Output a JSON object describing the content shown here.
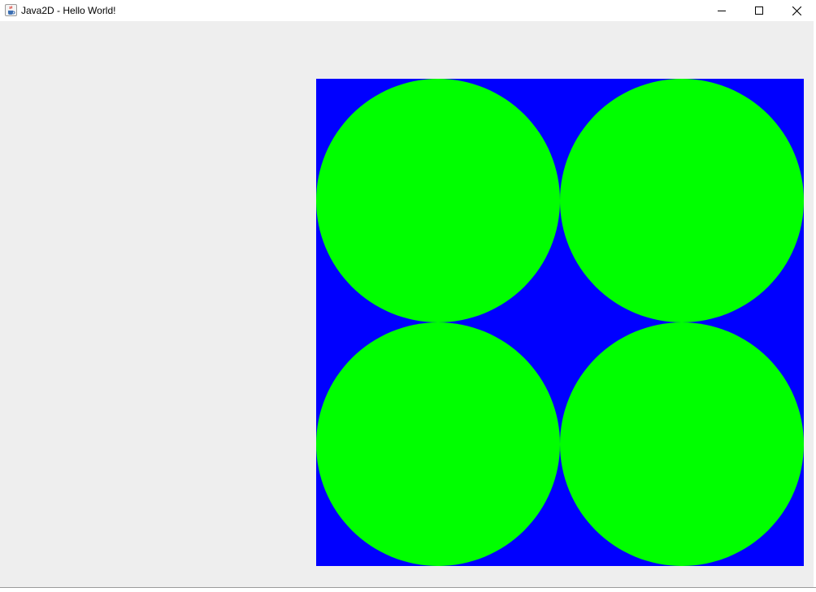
{
  "window": {
    "title": "Java2D - Hello World!",
    "icon": "java-cup-icon"
  },
  "controls": {
    "minimize": "minimize-icon",
    "maximize": "maximize-icon",
    "close": "close-icon"
  },
  "scene": {
    "background_color": "#0000ff",
    "circle_color": "#00ff00",
    "circle_count": 4
  }
}
